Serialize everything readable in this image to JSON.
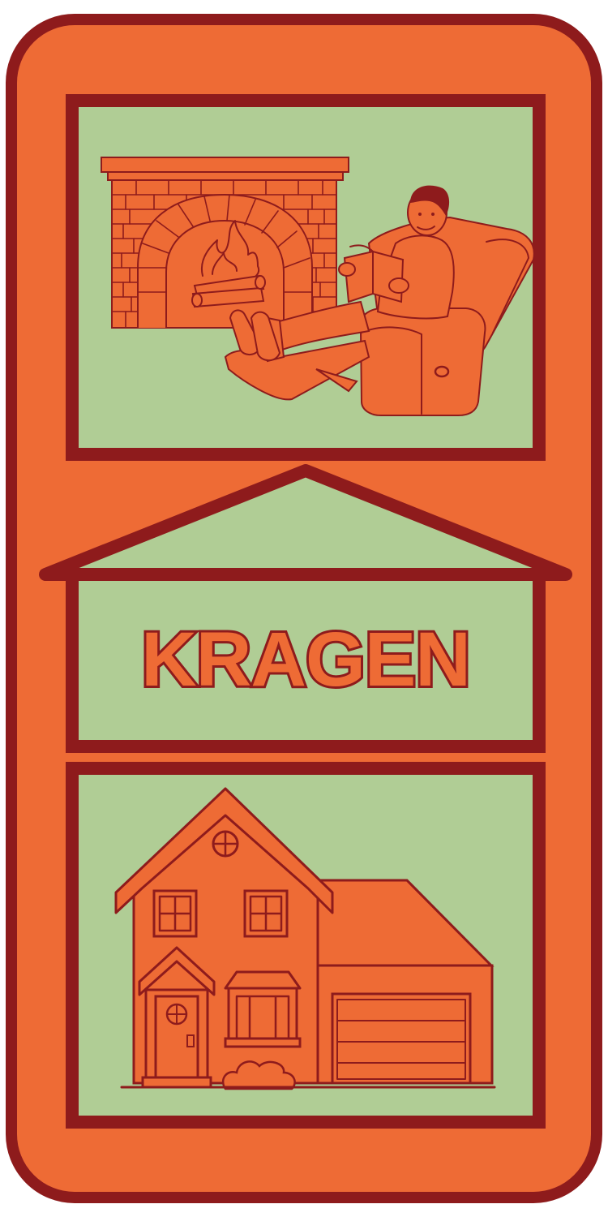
{
  "label": {
    "text": "KRAGEN"
  },
  "colors": {
    "background": "#ee6b35",
    "outline": "#8e1b1c",
    "panel": "#b0cd95"
  },
  "icons": {
    "top": "man-reading-in-recliner-by-fireplace-icon",
    "bottom": "two-story-house-with-garage-icon"
  }
}
